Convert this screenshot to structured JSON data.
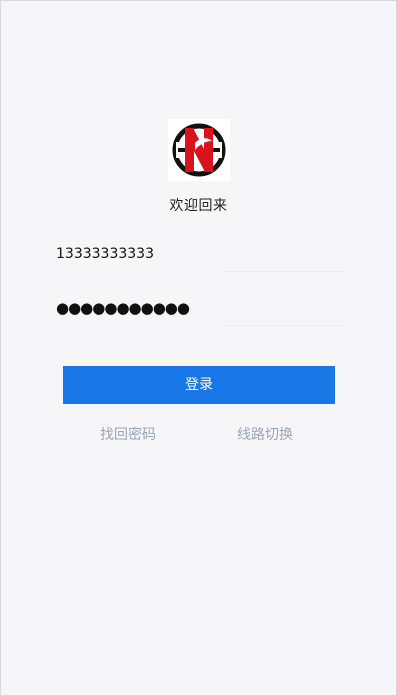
{
  "header": {
    "logo_icon": "hn-brand-logo",
    "welcome_text": "欢迎回来"
  },
  "form": {
    "phone_value": "13333333333",
    "password_value": "●●●●●●●●●●●"
  },
  "actions": {
    "login_label": "登录",
    "forgot_password_label": "找回密码",
    "switch_route_label": "线路切换"
  },
  "colors": {
    "background": "#f6f5f8",
    "primary": "#1876e6",
    "link": "#9aa6b6",
    "logo_red": "#d7141c",
    "logo_black": "#111111"
  }
}
